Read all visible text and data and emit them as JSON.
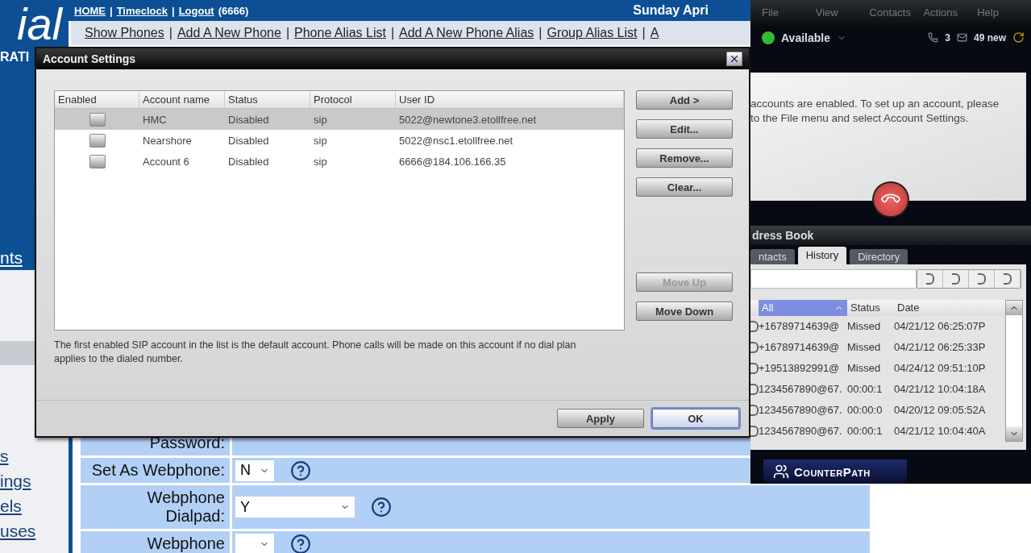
{
  "web": {
    "logo": "ial",
    "logo_sub": "RATI",
    "top_links": [
      {
        "kind": "link",
        "text": "HOME"
      },
      {
        "kind": "separator",
        "text": "|"
      },
      {
        "kind": "link",
        "text": "Timeclock"
      },
      {
        "kind": "separator",
        "text": "|"
      },
      {
        "kind": "link",
        "text": "Logout"
      }
    ],
    "user": "(6666)",
    "date": "Sunday Apri",
    "nav": [
      {
        "kind": "link",
        "text": "Show Phones"
      },
      {
        "kind": "separator",
        "text": "|"
      },
      {
        "kind": "link",
        "text": "Add A New Phone"
      },
      {
        "kind": "separator",
        "text": "|"
      },
      {
        "kind": "link",
        "text": "Phone Alias List"
      },
      {
        "kind": "separator",
        "text": "|"
      },
      {
        "kind": "link",
        "text": "Add A New Phone Alias"
      },
      {
        "kind": "separator",
        "text": "|"
      },
      {
        "kind": "link",
        "text": "Group Alias List"
      },
      {
        "kind": "separator",
        "text": "|"
      },
      {
        "kind": "link",
        "text": "A"
      }
    ],
    "sidebar": [
      "nts",
      "s",
      "ings",
      "els",
      "uses"
    ],
    "form": [
      {
        "label": "Password:",
        "kind": "text"
      },
      {
        "label": "Set As Webphone:",
        "kind": "select",
        "value": "N"
      },
      {
        "label": "Webphone Dialpad:",
        "kind": "wide-select",
        "value": "Y"
      },
      {
        "label": "Webphone",
        "kind": "select"
      }
    ]
  },
  "dialog": {
    "title": "Account Settings",
    "columns": [
      "Enabled",
      "Account name",
      "Status",
      "Protocol",
      "User ID"
    ],
    "accounts": [
      {
        "enabled": false,
        "name": "HMC",
        "status": "Disabled",
        "protocol": "sip",
        "user_id": "5022@newtone3.etollfree.net",
        "selected": true
      },
      {
        "enabled": false,
        "name": "Nearshore",
        "status": "Disabled",
        "protocol": "sip",
        "user_id": "5022@nsc1.etollfree.net",
        "selected": false
      },
      {
        "enabled": false,
        "name": "Account 6",
        "status": "Disabled",
        "protocol": "sip",
        "user_id": "6666@184.106.166.35",
        "selected": false
      }
    ],
    "side_buttons": [
      {
        "label": "Add >",
        "disabled": false
      },
      {
        "label": "Edit...",
        "disabled": false
      },
      {
        "label": "Remove...",
        "disabled": false
      },
      {
        "label": "Clear...",
        "disabled": false
      }
    ],
    "move_buttons": [
      {
        "label": "Move Up",
        "disabled": true
      },
      {
        "label": "Move Down",
        "disabled": false
      }
    ],
    "note": "The first enabled SIP account in the list is the default account. Phone calls will be made on this account if no dial plan applies to the dialed number.",
    "footer_buttons": [
      {
        "label": "Apply",
        "default": false
      },
      {
        "label": "OK",
        "default": true
      }
    ]
  },
  "softphone": {
    "menu": [
      "File",
      "View",
      "Contacts",
      "Actions",
      "Help"
    ],
    "presence": "Available",
    "missed": "3",
    "voicemail": "49 new",
    "message": [
      "accounts are enabled. To set up an account, please",
      "to the File menu and select Account Settings."
    ],
    "address_book": "dress Book",
    "tabs": [
      {
        "label": "ntacts",
        "selected": false
      },
      {
        "label": "History",
        "selected": true
      },
      {
        "label": "Directory",
        "selected": false
      }
    ],
    "columns": [
      "All",
      "Status",
      "Date"
    ],
    "history": [
      {
        "caller": "+16789714639@",
        "status": "Missed",
        "date": "04/21/12 06:25:07P"
      },
      {
        "caller": "+16789714639@",
        "status": "Missed",
        "date": "04/21/12 06:25:33P"
      },
      {
        "caller": "+19513892991@",
        "status": "Missed",
        "date": "04/24/12 09:51:10P"
      },
      {
        "caller": "1234567890@67.",
        "status": "00:00:1",
        "date": "04/21/12 10:04:18A"
      },
      {
        "caller": "1234567890@67.",
        "status": "00:00:0",
        "date": "04/20/12 09:05:52A"
      },
      {
        "caller": "1234567890@67.",
        "status": "00:00:1",
        "date": "04/21/12 10:04:40A"
      }
    ],
    "brand": "CounterPath"
  }
}
